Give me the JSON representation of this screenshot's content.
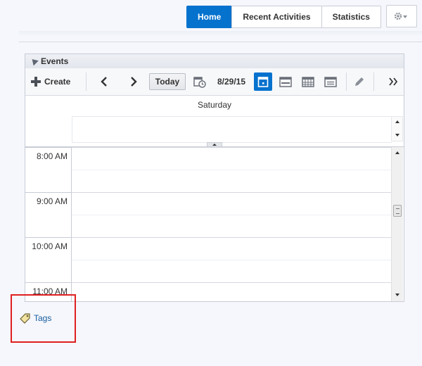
{
  "nav": {
    "tabs": [
      {
        "label": "Home",
        "active": true
      },
      {
        "label": "Recent Activities",
        "active": false
      },
      {
        "label": "Statistics",
        "active": false
      }
    ],
    "settings_icon": "gear-icon"
  },
  "events_panel": {
    "title": "Events",
    "toolbar": {
      "create_label": "Create",
      "today_label": "Today",
      "current_date": "8/29/15",
      "icons": [
        "plus-icon",
        "chevron-left-icon",
        "chevron-right-icon",
        "calendar-clock-icon",
        "day-view-icon",
        "week-view-icon",
        "month-view-icon",
        "list-view-icon",
        "edit-pencil-icon",
        "overflow-icon"
      ],
      "active_view": "day"
    },
    "day_name": "Saturday",
    "hours": [
      "8:00 AM",
      "9:00 AM",
      "10:00 AM",
      "11:00 AM"
    ]
  },
  "tags": {
    "label": "Tags",
    "icon": "tag-icon"
  },
  "colors": {
    "accent": "#0572ce",
    "link": "#145c9e",
    "highlight": "#e02020",
    "background": "#f6f7fc"
  }
}
